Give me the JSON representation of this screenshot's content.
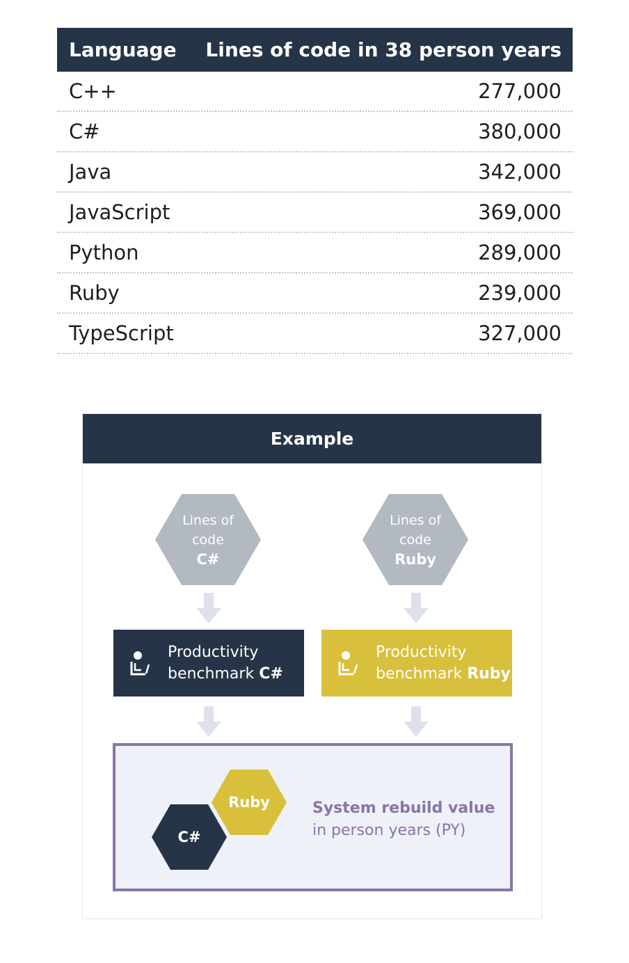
{
  "table": {
    "header": {
      "language": "Language",
      "loc": "Lines of code in 38 person years"
    },
    "rows": [
      {
        "language": "C++",
        "loc": "277,000"
      },
      {
        "language": "C#",
        "loc": "380,000"
      },
      {
        "language": "Java",
        "loc": "342,000"
      },
      {
        "language": "JavaScript",
        "loc": "369,000"
      },
      {
        "language": "Python",
        "loc": "289,000"
      },
      {
        "language": "Ruby",
        "loc": "239,000"
      },
      {
        "language": "TypeScript",
        "loc": "327,000"
      }
    ]
  },
  "example": {
    "title": "Example",
    "hex_left": {
      "line1": "Lines of",
      "line2": "code",
      "lang": "C#"
    },
    "hex_right": {
      "line1": "Lines of",
      "line2": "code",
      "lang": "Ruby"
    },
    "bench_left": {
      "line1": "Productivity",
      "line2": "benchmark",
      "lang": "C#"
    },
    "bench_right": {
      "line1": "Productivity",
      "line2": "benchmark",
      "lang": "Ruby"
    },
    "result": {
      "hex_csharp": "C#",
      "hex_ruby": "Ruby",
      "title": "System rebuild value",
      "subtitle": "in person years (PY)"
    }
  },
  "colors": {
    "navy": "#253447",
    "yellow": "#d8c03c",
    "gray": "#b2b9c0",
    "purple": "#8a74a9",
    "result_bg": "#eef1f7"
  },
  "icons": [
    "person-at-desk-icon",
    "down-arrow-icon"
  ]
}
